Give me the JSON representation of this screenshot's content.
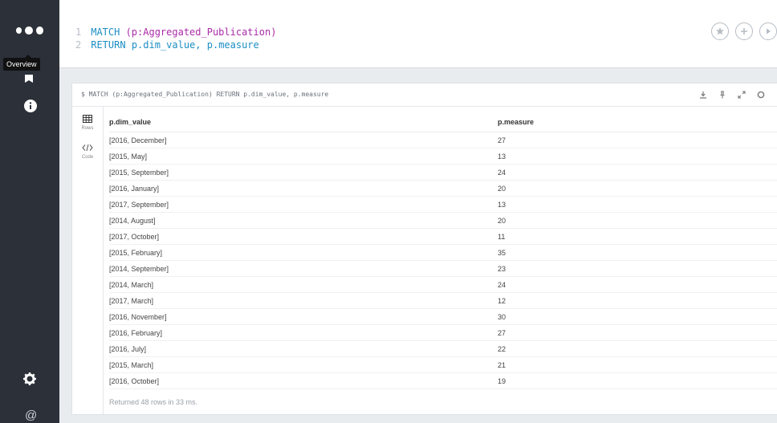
{
  "sidebar": {
    "tooltip": "Overview",
    "icons": [
      "dots-logo-icon",
      "star-icon",
      "info-icon",
      "gear-icon",
      "at-icon"
    ],
    "at_symbol": "@"
  },
  "editor": {
    "lines": [
      {
        "num": "1",
        "keyword": "MATCH",
        "rest": " (p:Aggregated_Publication)"
      },
      {
        "num": "2",
        "keyword": "RETURN",
        "rest": " p.dim_value, p.measure"
      }
    ],
    "buttons": [
      "favorite-star-icon",
      "add-plus-icon",
      "run-play-icon"
    ]
  },
  "frame": {
    "title": "$ MATCH (p:Aggregated_Publication) RETURN p.dim_value, p.measure",
    "actions": [
      "download-icon",
      "pin-icon",
      "expand-icon",
      "close-icon"
    ],
    "views": [
      {
        "label": "Rows",
        "icon": "table-icon"
      },
      {
        "label": "Code",
        "icon": "code-icon"
      }
    ],
    "columns": [
      "p.dim_value",
      "p.measure"
    ],
    "rows": [
      [
        "[2016, December]",
        "27"
      ],
      [
        "[2015, May]",
        "13"
      ],
      [
        "[2015, September]",
        "24"
      ],
      [
        "[2016, January]",
        "20"
      ],
      [
        "[2017, September]",
        "13"
      ],
      [
        "[2014, August]",
        "20"
      ],
      [
        "[2017, October]",
        "11"
      ],
      [
        "[2015, February]",
        "35"
      ],
      [
        "[2014, September]",
        "23"
      ],
      [
        "[2014, March]",
        "24"
      ],
      [
        "[2017, March]",
        "12"
      ],
      [
        "[2016, November]",
        "30"
      ],
      [
        "[2016, February]",
        "27"
      ],
      [
        "[2016, July]",
        "22"
      ],
      [
        "[2015, March]",
        "21"
      ],
      [
        "[2016, October]",
        "19"
      ]
    ],
    "status": "Returned 48 rows in 33 ms."
  }
}
